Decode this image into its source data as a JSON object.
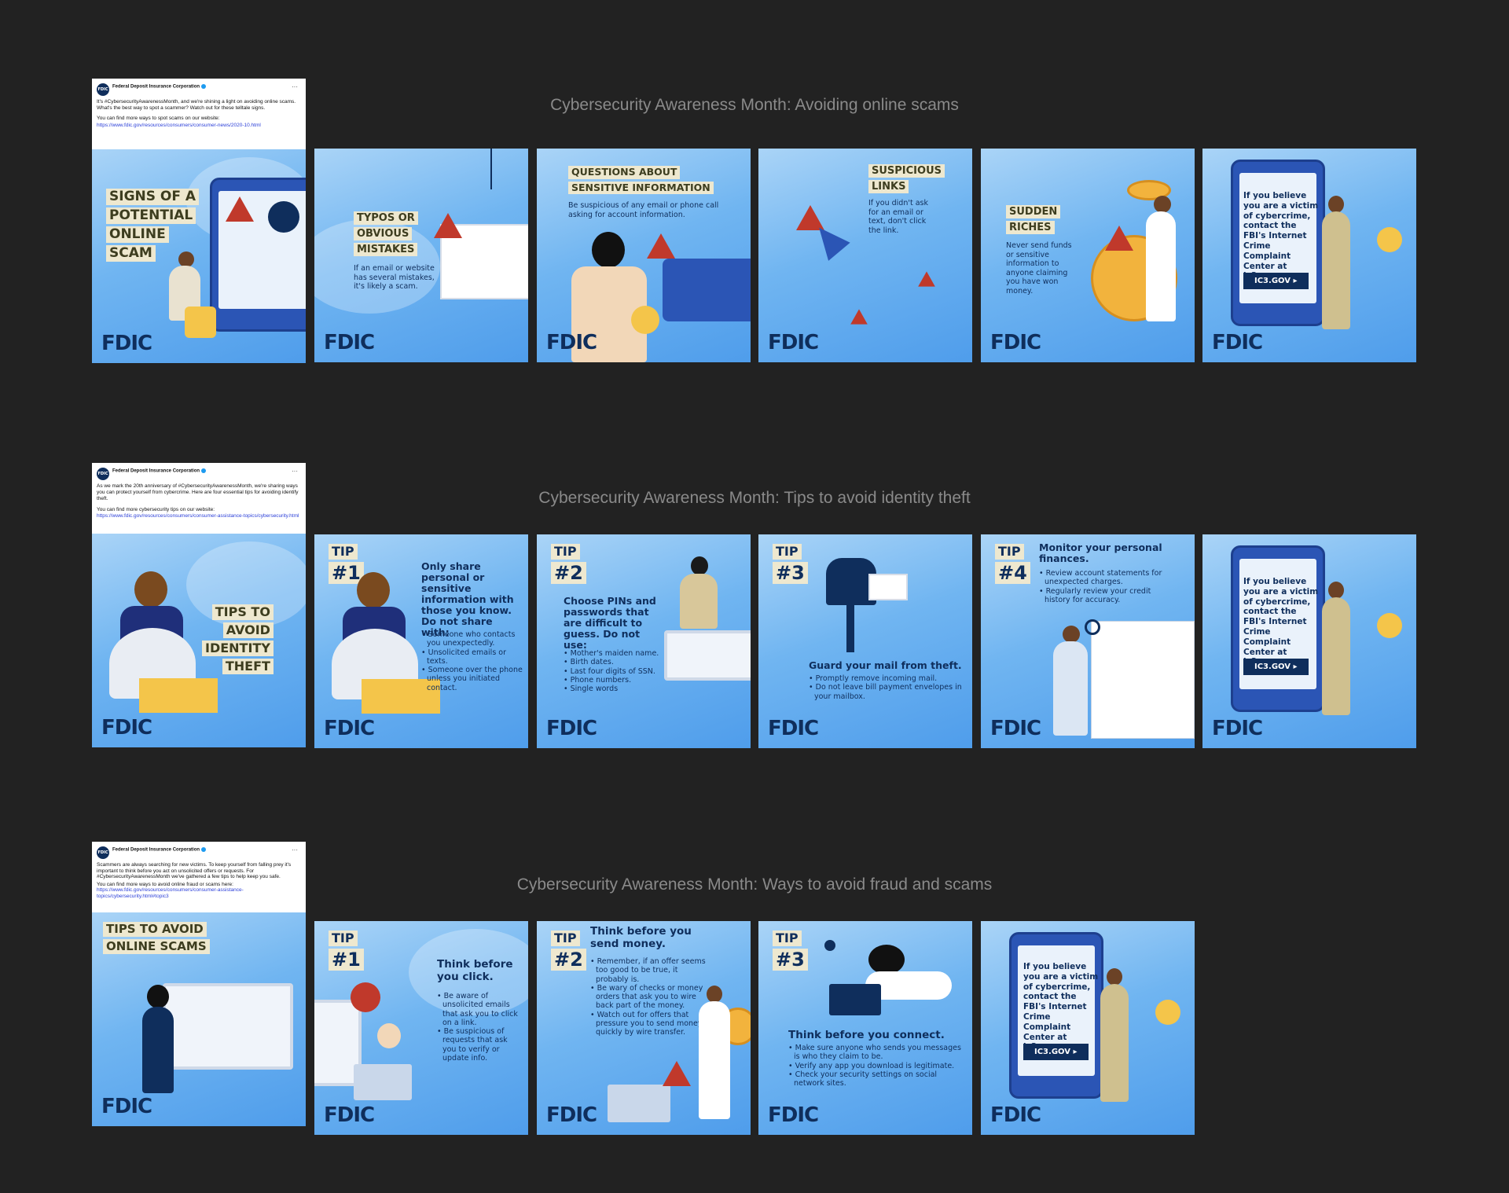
{
  "rows": [
    {
      "title": "Cybersecurity Awareness Month: Avoiding online scams",
      "post": {
        "org": "Federal Deposit Insurance Corporation",
        "text1": "It's #CybersecurityAwarenessMonth, and we're shining a light on avoiding online scams. What's the best way to spot a scammer? Watch out for these telltale signs.",
        "text2": "You can find more ways to spot scams on our website: ",
        "link": "https://www.fdic.gov/resources/consumers/consumer-news/2020-10.html",
        "headline": [
          "SIGNS OF A",
          "POTENTIAL",
          "ONLINE",
          "SCAM"
        ]
      },
      "cards": [
        {
          "headline": [
            "TYPOS OR",
            "OBVIOUS",
            "MISTAKES"
          ],
          "body": "If an email or website has several mistakes, it's likely a scam."
        },
        {
          "headline": [
            "QUESTIONS ABOUT",
            "SENSITIVE INFORMATION"
          ],
          "body": "Be suspicious of any email or phone call asking for account information."
        },
        {
          "headline": [
            "SUSPICIOUS",
            "LINKS"
          ],
          "body": "If you didn't ask for an email or text, don't click the link."
        },
        {
          "headline": [
            "SUDDEN",
            "RICHES"
          ],
          "body": "Never send funds or sensitive information to anyone claiming you have won money."
        }
      ]
    },
    {
      "title": "Cybersecurity Awareness Month: Tips to avoid identity theft",
      "post": {
        "org": "Federal Deposit Insurance Corporation",
        "text1": "As we mark the 20th anniversary of #CybersecurityAwarenessMonth, we're sharing ways you can protect yourself from cybercrime. Here are four essential tips for avoiding identify theft.",
        "text2": "You can find more cybersecurity tips on our website: ",
        "link": "https://www.fdic.gov/resources/consumers/consumer-assistance-topics/cybersecurity.html",
        "headline": [
          "TIPS TO",
          "AVOID",
          "IDENTITY",
          "THEFT"
        ]
      },
      "tips": [
        {
          "num": "#1",
          "heading": "Only share personal or sensitive information with those you know. Do not share with:",
          "bullets": [
            "Someone who contacts you unexpectedly.",
            "Unsolicited emails or texts.",
            "Someone over the phone unless you initiated contact."
          ]
        },
        {
          "num": "#2",
          "heading": "Choose PINs and passwords that are difficult to guess. Do not use:",
          "bullets": [
            "Mother's maiden name.",
            "Birth dates.",
            "Last four digits of SSN.",
            "Phone numbers.",
            "Single words"
          ]
        },
        {
          "num": "#3",
          "heading": "Guard your mail from theft.",
          "bullets": [
            "Promptly remove incoming mail.",
            "Do not leave bill payment envelopes in your mailbox."
          ]
        },
        {
          "num": "#4",
          "heading": "Monitor your personal finances.",
          "bullets": [
            "Review account statements for unexpected charges.",
            "Regularly review your credit history for accuracy."
          ]
        }
      ]
    },
    {
      "title": "Cybersecurity Awareness Month: Ways to avoid fraud and scams",
      "post": {
        "org": "Federal Deposit Insurance Corporation",
        "text1": "Scammers are always searching for new victims. To keep yourself from falling prey it's important to think before you act on unsolicited offers or requests. For #CybersecurityAwarenessMonth we've gathered a few tips to help keep you safe.",
        "text2": "You can find more ways to avoid online fraud or scams here: ",
        "link": "https://www.fdic.gov/resources/consumers/consumer-assistance-topics/cybersecurity.html#topic3",
        "headline": [
          "TIPS TO AVOID",
          "ONLINE SCAMS"
        ]
      },
      "tips": [
        {
          "num": "#1",
          "heading": "Think before you click.",
          "bullets": [
            "Be aware of unsolicited emails that ask you to click on a link.",
            "Be suspicious of requests that ask you to verify or update info."
          ]
        },
        {
          "num": "#2",
          "heading": "Think before you send money.",
          "bullets": [
            "Remember, if an offer seems too good to be true, it probably is.",
            "Be wary of checks or money orders that ask you to wire back part of the money.",
            "Watch out for offers that pressure you to send money quickly by wire transfer."
          ]
        },
        {
          "num": "#3",
          "heading": "Think before you connect.",
          "bullets": [
            "Make sure anyone who sends you messages is who they claim to be.",
            "Verify any app you download is legitimate.",
            "Check your security settings on social network sites."
          ]
        }
      ]
    }
  ],
  "ic3": {
    "text": "If you believe you are a victim of cybercrime, contact the FBI's Internet Crime Complaint Center at ic3.gov.",
    "button": "IC3.GOV ▸"
  },
  "brand": {
    "logo": "FDIC",
    "avatar": "FDIC",
    "more": "···",
    "tip_word": "TIP"
  },
  "colors": {
    "background": "#222222",
    "navy": "#0f2e5c",
    "sky": "#70b5f1",
    "label": "#eee8cf",
    "warning": "#c0392b"
  }
}
